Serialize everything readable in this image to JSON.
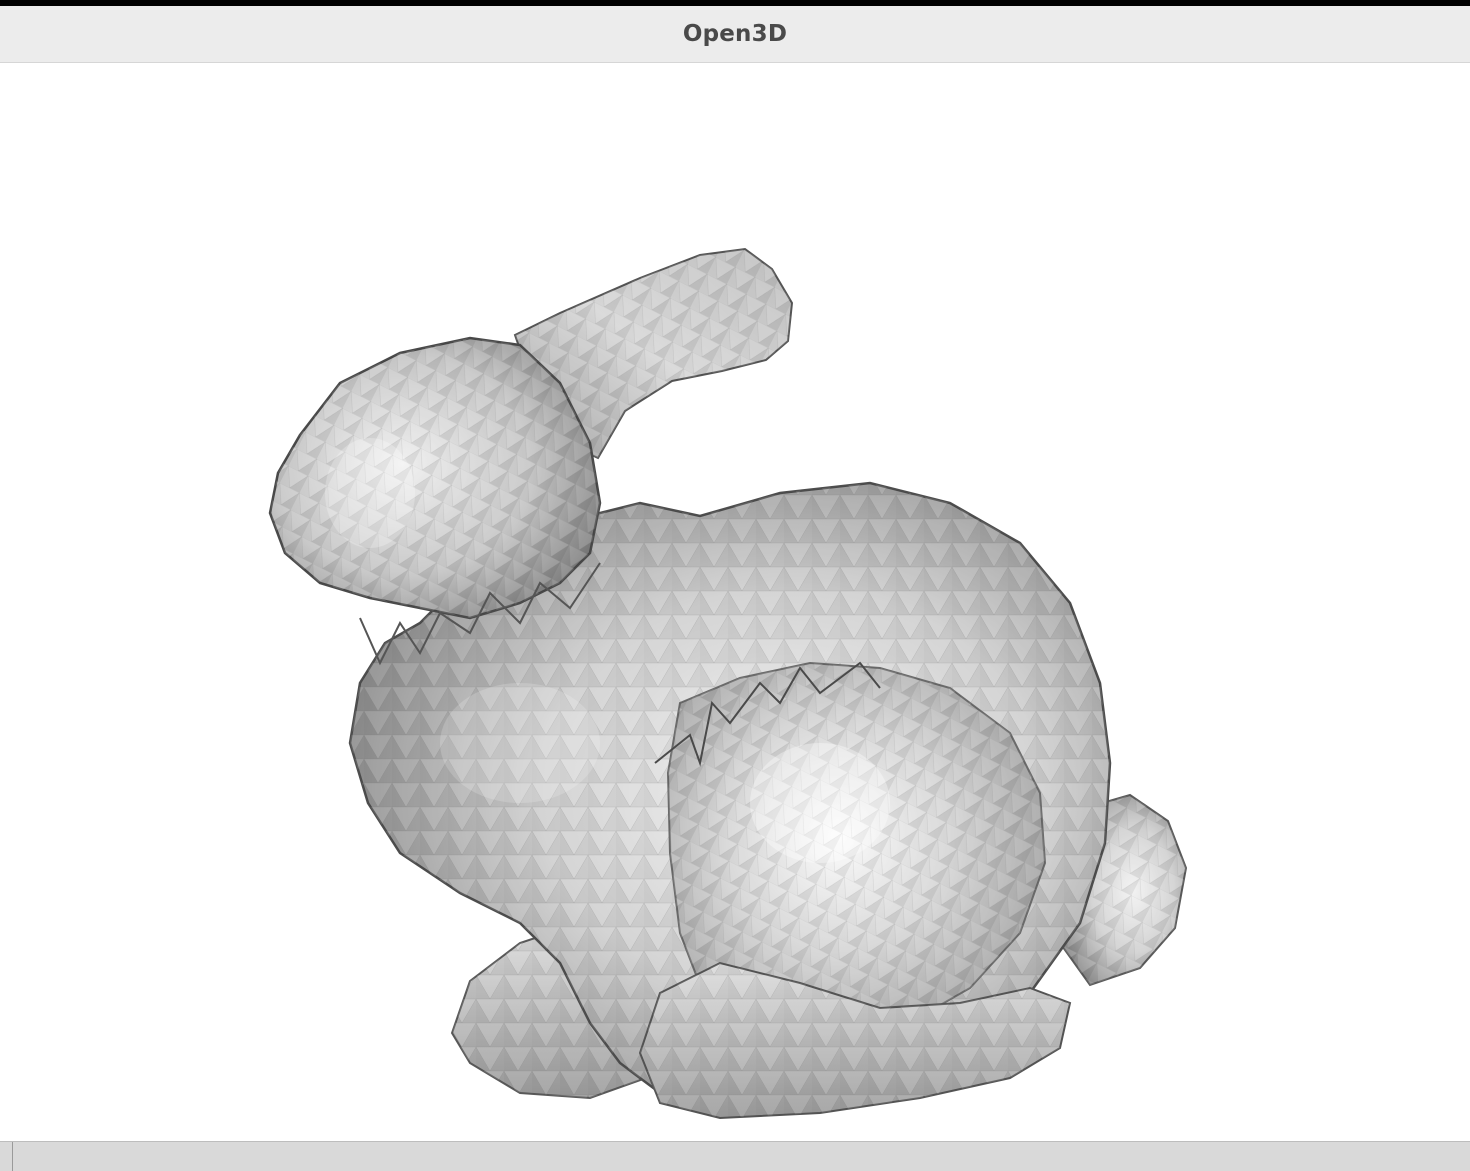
{
  "window": {
    "title": "Open3D"
  },
  "viewport": {
    "background_color": "#ffffff",
    "model": "bunny-mesh",
    "mesh_color": "#b4b4b4"
  }
}
